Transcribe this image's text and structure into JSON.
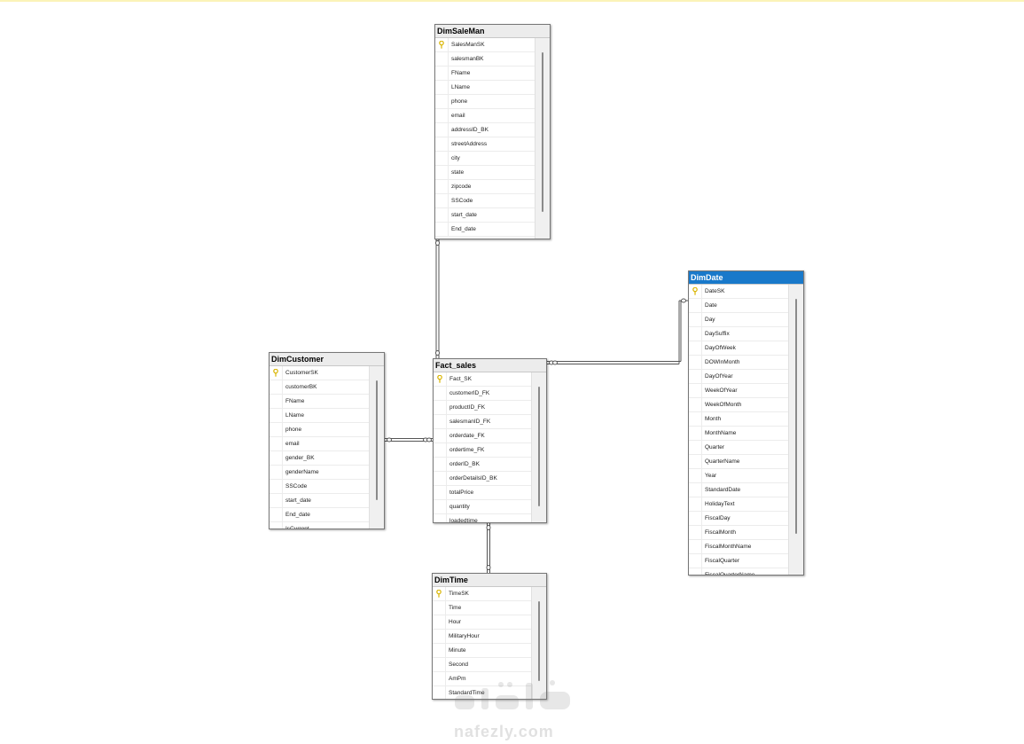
{
  "tables": {
    "dimsaleman": {
      "title": "DimSaleMan",
      "columns": [
        "SalesManSK",
        "salesmanBK",
        "FName",
        "LName",
        "phone",
        "email",
        "addressID_BK",
        "streetAddress",
        "city",
        "state",
        "zipcode",
        "SSCode",
        "start_date",
        "End_date"
      ]
    },
    "dimdate": {
      "title": "DimDate",
      "columns": [
        "DateSK",
        "Date",
        "Day",
        "DaySuffix",
        "DayOfWeek",
        "DOWInMonth",
        "DayOfYear",
        "WeekOfYear",
        "WeekOfMonth",
        "Month",
        "MonthName",
        "Quarter",
        "QuarterName",
        "Year",
        "StandardDate",
        "HolidayText",
        "FiscalDay",
        "FiscalMonth",
        "FiscalMonthName",
        "FiscalQuarter",
        "FiscalQuarterName"
      ]
    },
    "dimcustomer": {
      "title": "DimCustomer",
      "columns": [
        "CustomerSK",
        "customerBK",
        "FName",
        "LName",
        "phone",
        "email",
        "gender_BK",
        "genderName",
        "SSCode",
        "start_date",
        "End_date",
        "IsCurrent"
      ]
    },
    "fact_sales": {
      "title": "Fact_sales",
      "columns": [
        "Fact_SK",
        "customerID_FK",
        "productID_FK",
        "salesmanID_FK",
        "orderdate_FK",
        "ordertime_FK",
        "orderID_BK",
        "orderDetailsID_BK",
        "totalPrice",
        "quantity",
        "loadedtime"
      ]
    },
    "dimtime": {
      "title": "DimTime",
      "columns": [
        "TimeSK",
        "Time",
        "Hour",
        "MilitaryHour",
        "Minute",
        "Second",
        "AmPm",
        "StandardTime"
      ]
    }
  },
  "icons": {
    "primary_key": "key-icon"
  },
  "colors": {
    "selected_header": "#1979ca",
    "key": "#d9b400"
  },
  "watermark": {
    "text": "nafezly.com"
  }
}
